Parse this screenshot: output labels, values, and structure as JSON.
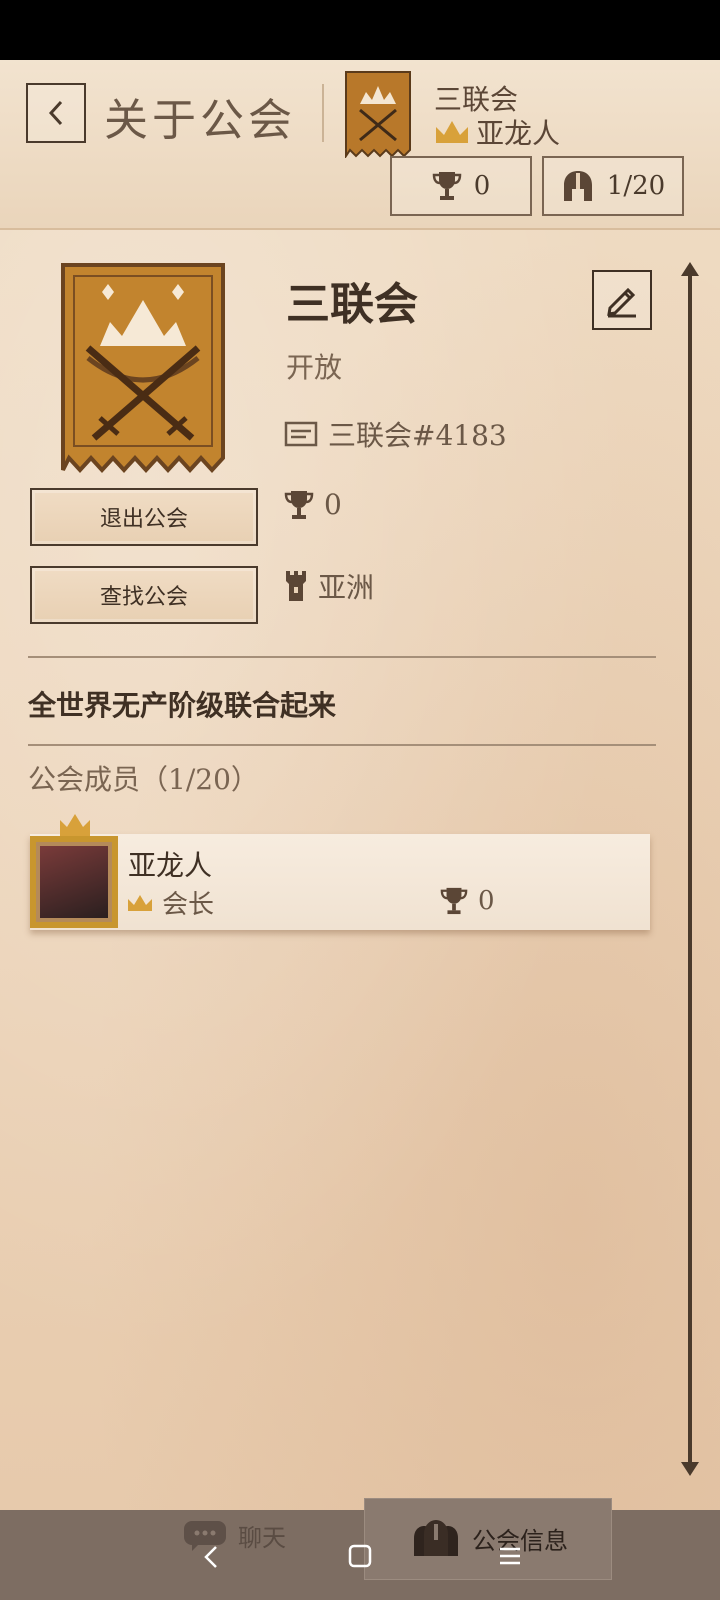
{
  "header": {
    "title": "关于公会",
    "guild_name": "三联会",
    "leader_name": "亚龙人",
    "trophy_count": "0",
    "member_count": "1/20"
  },
  "guild": {
    "name": "三联会",
    "status": "开放",
    "tag": "三联会#4183",
    "trophies": "0",
    "region": "亚洲",
    "motto": "全世界无产阶级联合起来"
  },
  "buttons": {
    "leave": "退出公会",
    "find": "查找公会"
  },
  "members": {
    "label": "公会成员",
    "count": "（1/20）",
    "list": [
      {
        "name": "亚龙人",
        "role": "会长",
        "trophies": "0"
      }
    ]
  },
  "tabs": {
    "chat": "聊天",
    "guild_info": "公会信息"
  },
  "colors": {
    "crown": "#d8a13a",
    "ink": "#4a3a2c",
    "banner": "#b8782a"
  },
  "icons": [
    "back-icon",
    "trophy-icon",
    "helmet-icon",
    "edit-icon",
    "id-card-icon",
    "tower-icon",
    "crown-icon",
    "chat-icon",
    "guild-icon"
  ]
}
